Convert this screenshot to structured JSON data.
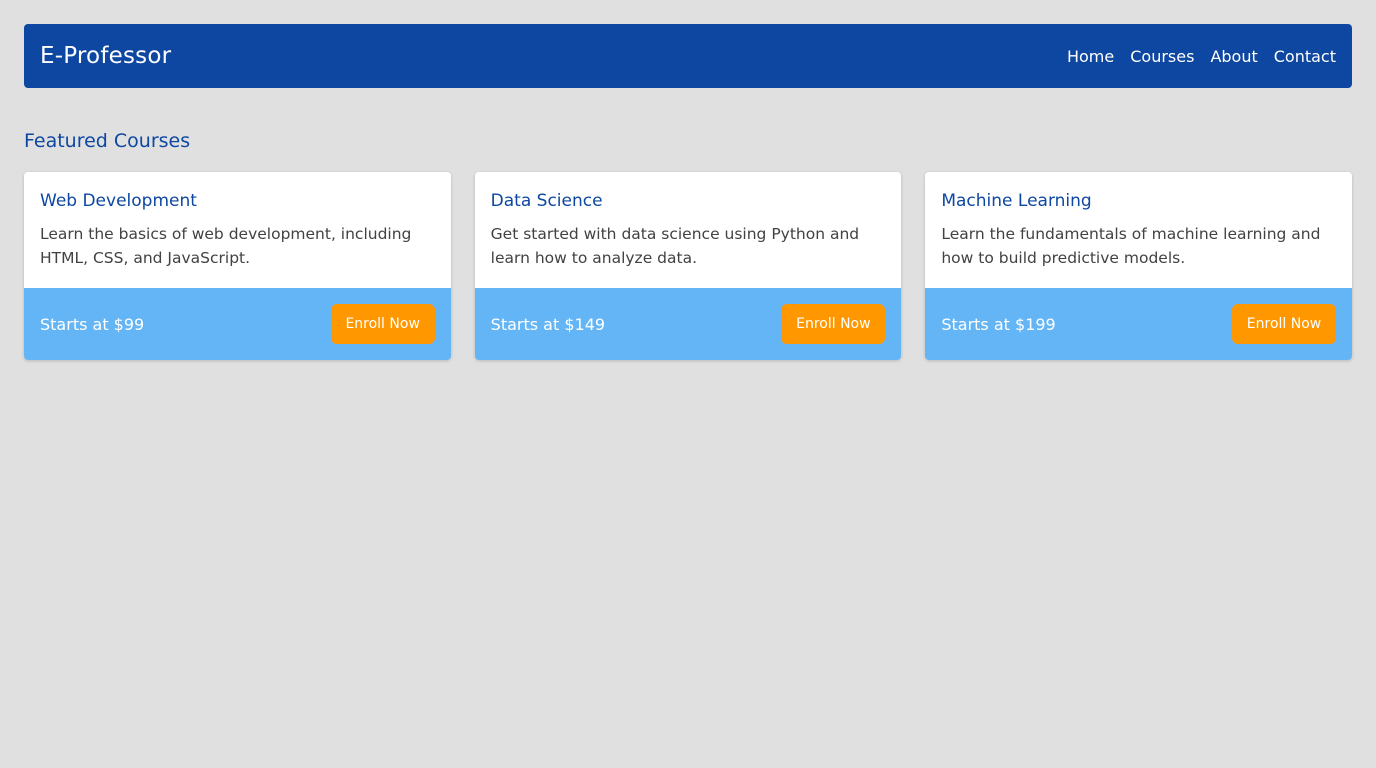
{
  "header": {
    "brand": "E-Professor",
    "nav": [
      {
        "label": "Home"
      },
      {
        "label": "Courses"
      },
      {
        "label": "About"
      },
      {
        "label": "Contact"
      }
    ]
  },
  "main": {
    "section_title": "Featured Courses",
    "courses": [
      {
        "title": "Web Development",
        "description": "Learn the basics of web development, including HTML, CSS, and JavaScript.",
        "price": "Starts at $99",
        "button": "Enroll Now"
      },
      {
        "title": "Data Science",
        "description": "Get started with data science using Python and learn how to analyze data.",
        "price": "Starts at $149",
        "button": "Enroll Now"
      },
      {
        "title": "Machine Learning",
        "description": "Learn the fundamentals of machine learning and how to build predictive models.",
        "price": "Starts at $199",
        "button": "Enroll Now"
      }
    ]
  },
  "colors": {
    "background": "#e0e0e0",
    "header": "#0d47a1",
    "accent_text": "#0d47a1",
    "card_footer": "#64b5f6",
    "button": "#ff9800"
  }
}
